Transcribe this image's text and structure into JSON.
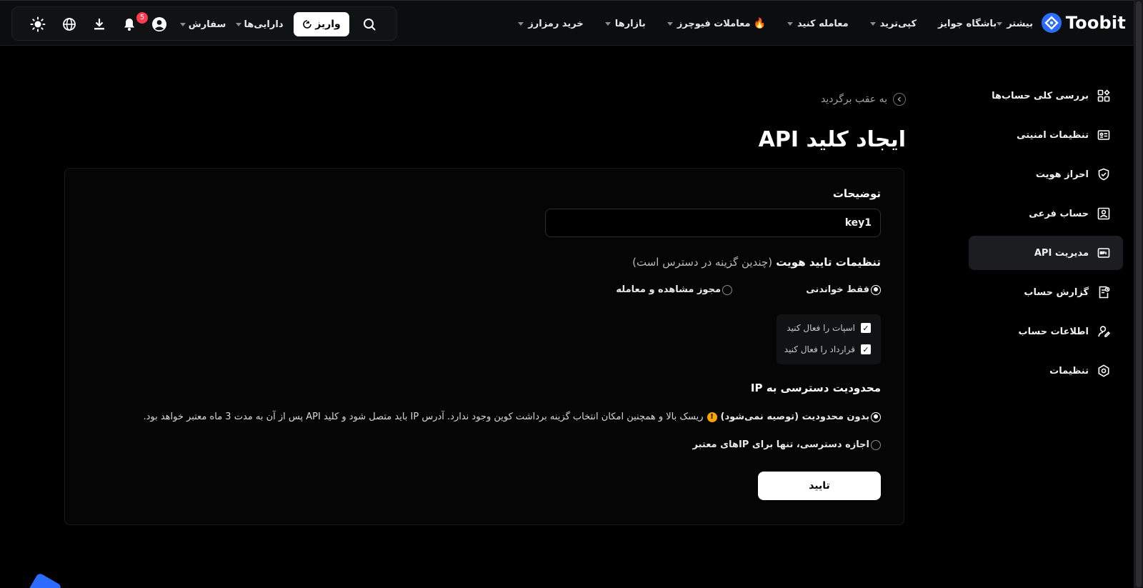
{
  "brand": {
    "name": "Toobit"
  },
  "nav": {
    "items": [
      {
        "label": "خرید رمزارز",
        "caret": true
      },
      {
        "label": "بازارها",
        "caret": true
      },
      {
        "label": "معاملات فیوچرز",
        "caret": true,
        "fire": true
      },
      {
        "label": "معامله کنید",
        "caret": true
      },
      {
        "label": "کپی‌ترید",
        "caret": true
      },
      {
        "label": "باشگاه جوایز",
        "caret": false
      },
      {
        "label": "بیشتر",
        "caret": true
      }
    ]
  },
  "tools": {
    "deposit_label": "واریز",
    "assets_label": "دارایی‌ها",
    "orders_label": "سفارش",
    "notification_count": "5"
  },
  "sidebar": {
    "items": [
      {
        "label": "بررسی کلی حساب‌ها",
        "icon": "dashboard-icon",
        "active": false
      },
      {
        "label": "تنظیمات امنیتی",
        "icon": "id-card-icon",
        "active": false
      },
      {
        "label": "احراز هویت",
        "icon": "shield-check-icon",
        "active": false
      },
      {
        "label": "حساب فرعی",
        "icon": "sub-account-icon",
        "active": false
      },
      {
        "label": "مدیریت API",
        "icon": "api-icon",
        "active": true
      },
      {
        "label": "گزارش حساب",
        "icon": "report-icon",
        "active": false
      },
      {
        "label": "اطلاعات حساب",
        "icon": "user-edit-icon",
        "active": false
      },
      {
        "label": "تنظیمات",
        "icon": "settings-icon",
        "active": false
      }
    ]
  },
  "main": {
    "back_label": "به عقب برگردید",
    "title": "ایجاد کلید API",
    "description_label": "توضیحات",
    "description_value": "key1",
    "auth": {
      "label": "تنظیمات تایید هویت",
      "hint": "(چندین گزینه در دسترس است)",
      "read_only": "فقط خواندنی",
      "view_trade": "مجوز مشاهده و معامله",
      "selected": "read_only",
      "spot_label": "اسپات را فعال کنید",
      "contract_label": "قرارداد را فعال کنید",
      "spot_checked": true,
      "contract_checked": true
    },
    "ip": {
      "label": "محدودیت دسترسی به IP",
      "unrestricted": "بدون محدودیت (توصیه نمی‌شود)",
      "unrestricted_note": "ریسک بالا و همچنین امکان انتخاب گزینه برداشت کوین وجود ندارد. آدرس IP باید متصل شود و کلید API پس از آن به مدت 3 ماه معتبر خواهد بود.",
      "trusted_only": "اجازه دسترسی، تنها برای IPهای معتبر",
      "selected": "unrestricted"
    },
    "confirm_label": "تایید"
  },
  "colors": {
    "accent": "#2b6bff",
    "warning": "#f7a600",
    "badge": "#ff3b4e",
    "background": "#000000"
  }
}
